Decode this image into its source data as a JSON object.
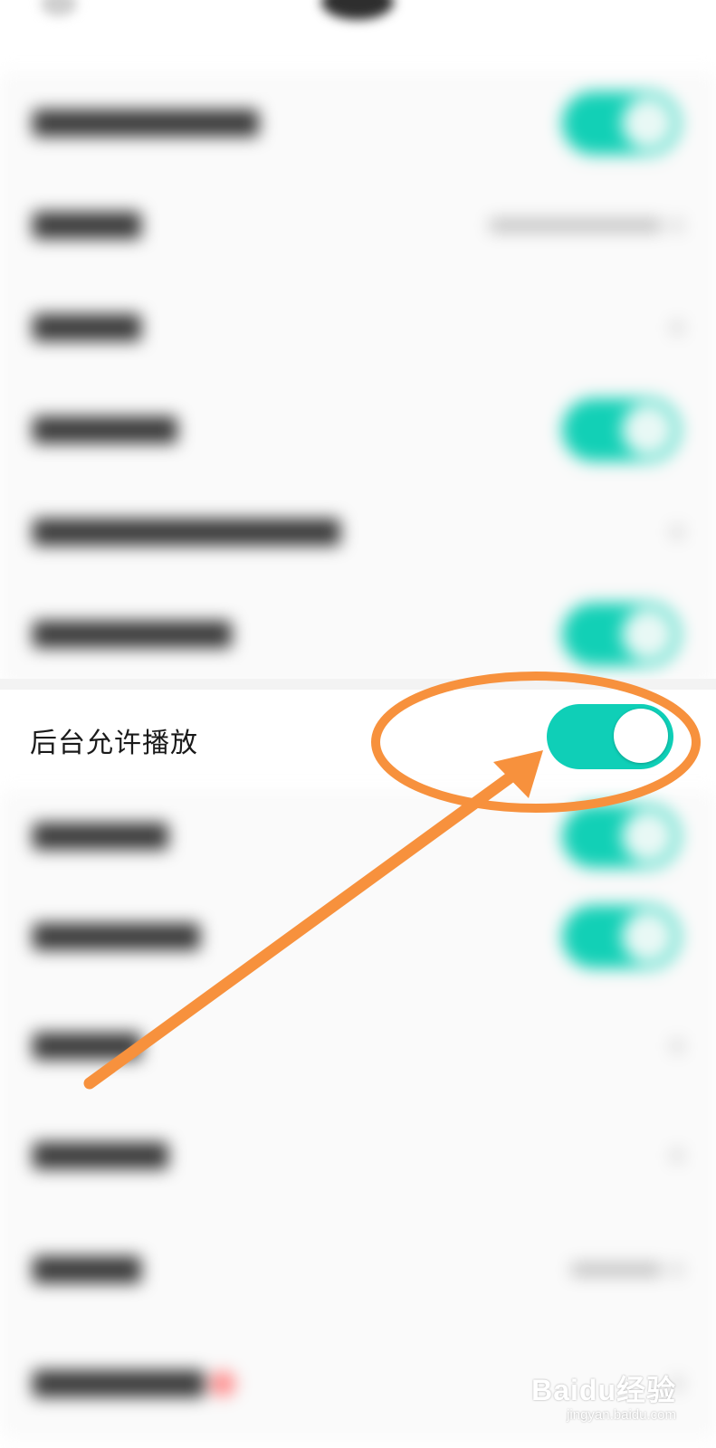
{
  "setting": {
    "label": "后台允许播放",
    "toggle_on": true
  },
  "colors": {
    "toggle_on": "#0fcfb7",
    "annotation": "#f7913d"
  },
  "watermark": {
    "logo": "Baidu经验",
    "url": "jingyan.baidu.com"
  }
}
